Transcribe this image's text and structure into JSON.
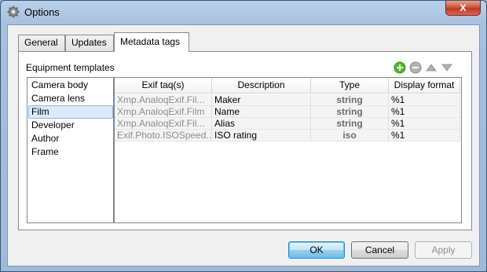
{
  "window": {
    "title": "Options",
    "close_label": "X"
  },
  "tabs": [
    {
      "label": "General",
      "active": false
    },
    {
      "label": "Updates",
      "active": false
    },
    {
      "label": "Metadata tags",
      "active": true
    }
  ],
  "section": {
    "label": "Equipment templates"
  },
  "toolbar": {
    "icons": [
      "add-icon",
      "remove-icon",
      "move-up-icon",
      "move-down-icon"
    ],
    "colors": {
      "add": "#5ab42c",
      "remove": "#9a9a9a",
      "arrows": "#a0a0a0"
    }
  },
  "templates": {
    "items": [
      "Camera body",
      "Camera lens",
      "Film",
      "Developer",
      "Author",
      "Frame"
    ],
    "selected": "Film"
  },
  "table": {
    "headers": {
      "exif": "Exif taq(s)",
      "description": "Description",
      "type": "Type",
      "format": "Display format"
    },
    "rows": [
      {
        "exif": "Xmp.AnaloqExif.Fil...",
        "description": "Maker",
        "type": "string",
        "format": "%1"
      },
      {
        "exif": "Xmp.AnaloqExif.Film",
        "description": "Name",
        "type": "string",
        "format": "%1"
      },
      {
        "exif": "Xmp.AnaloqExif.Fil...",
        "description": "Alias",
        "type": "string",
        "format": "%1"
      },
      {
        "exif": "Exif.Photo.ISOSpeed...",
        "description": "ISO rating",
        "type": "iso",
        "format": "%1"
      }
    ]
  },
  "buttons": {
    "ok": "OK",
    "cancel": "Cancel",
    "apply": "Apply"
  }
}
